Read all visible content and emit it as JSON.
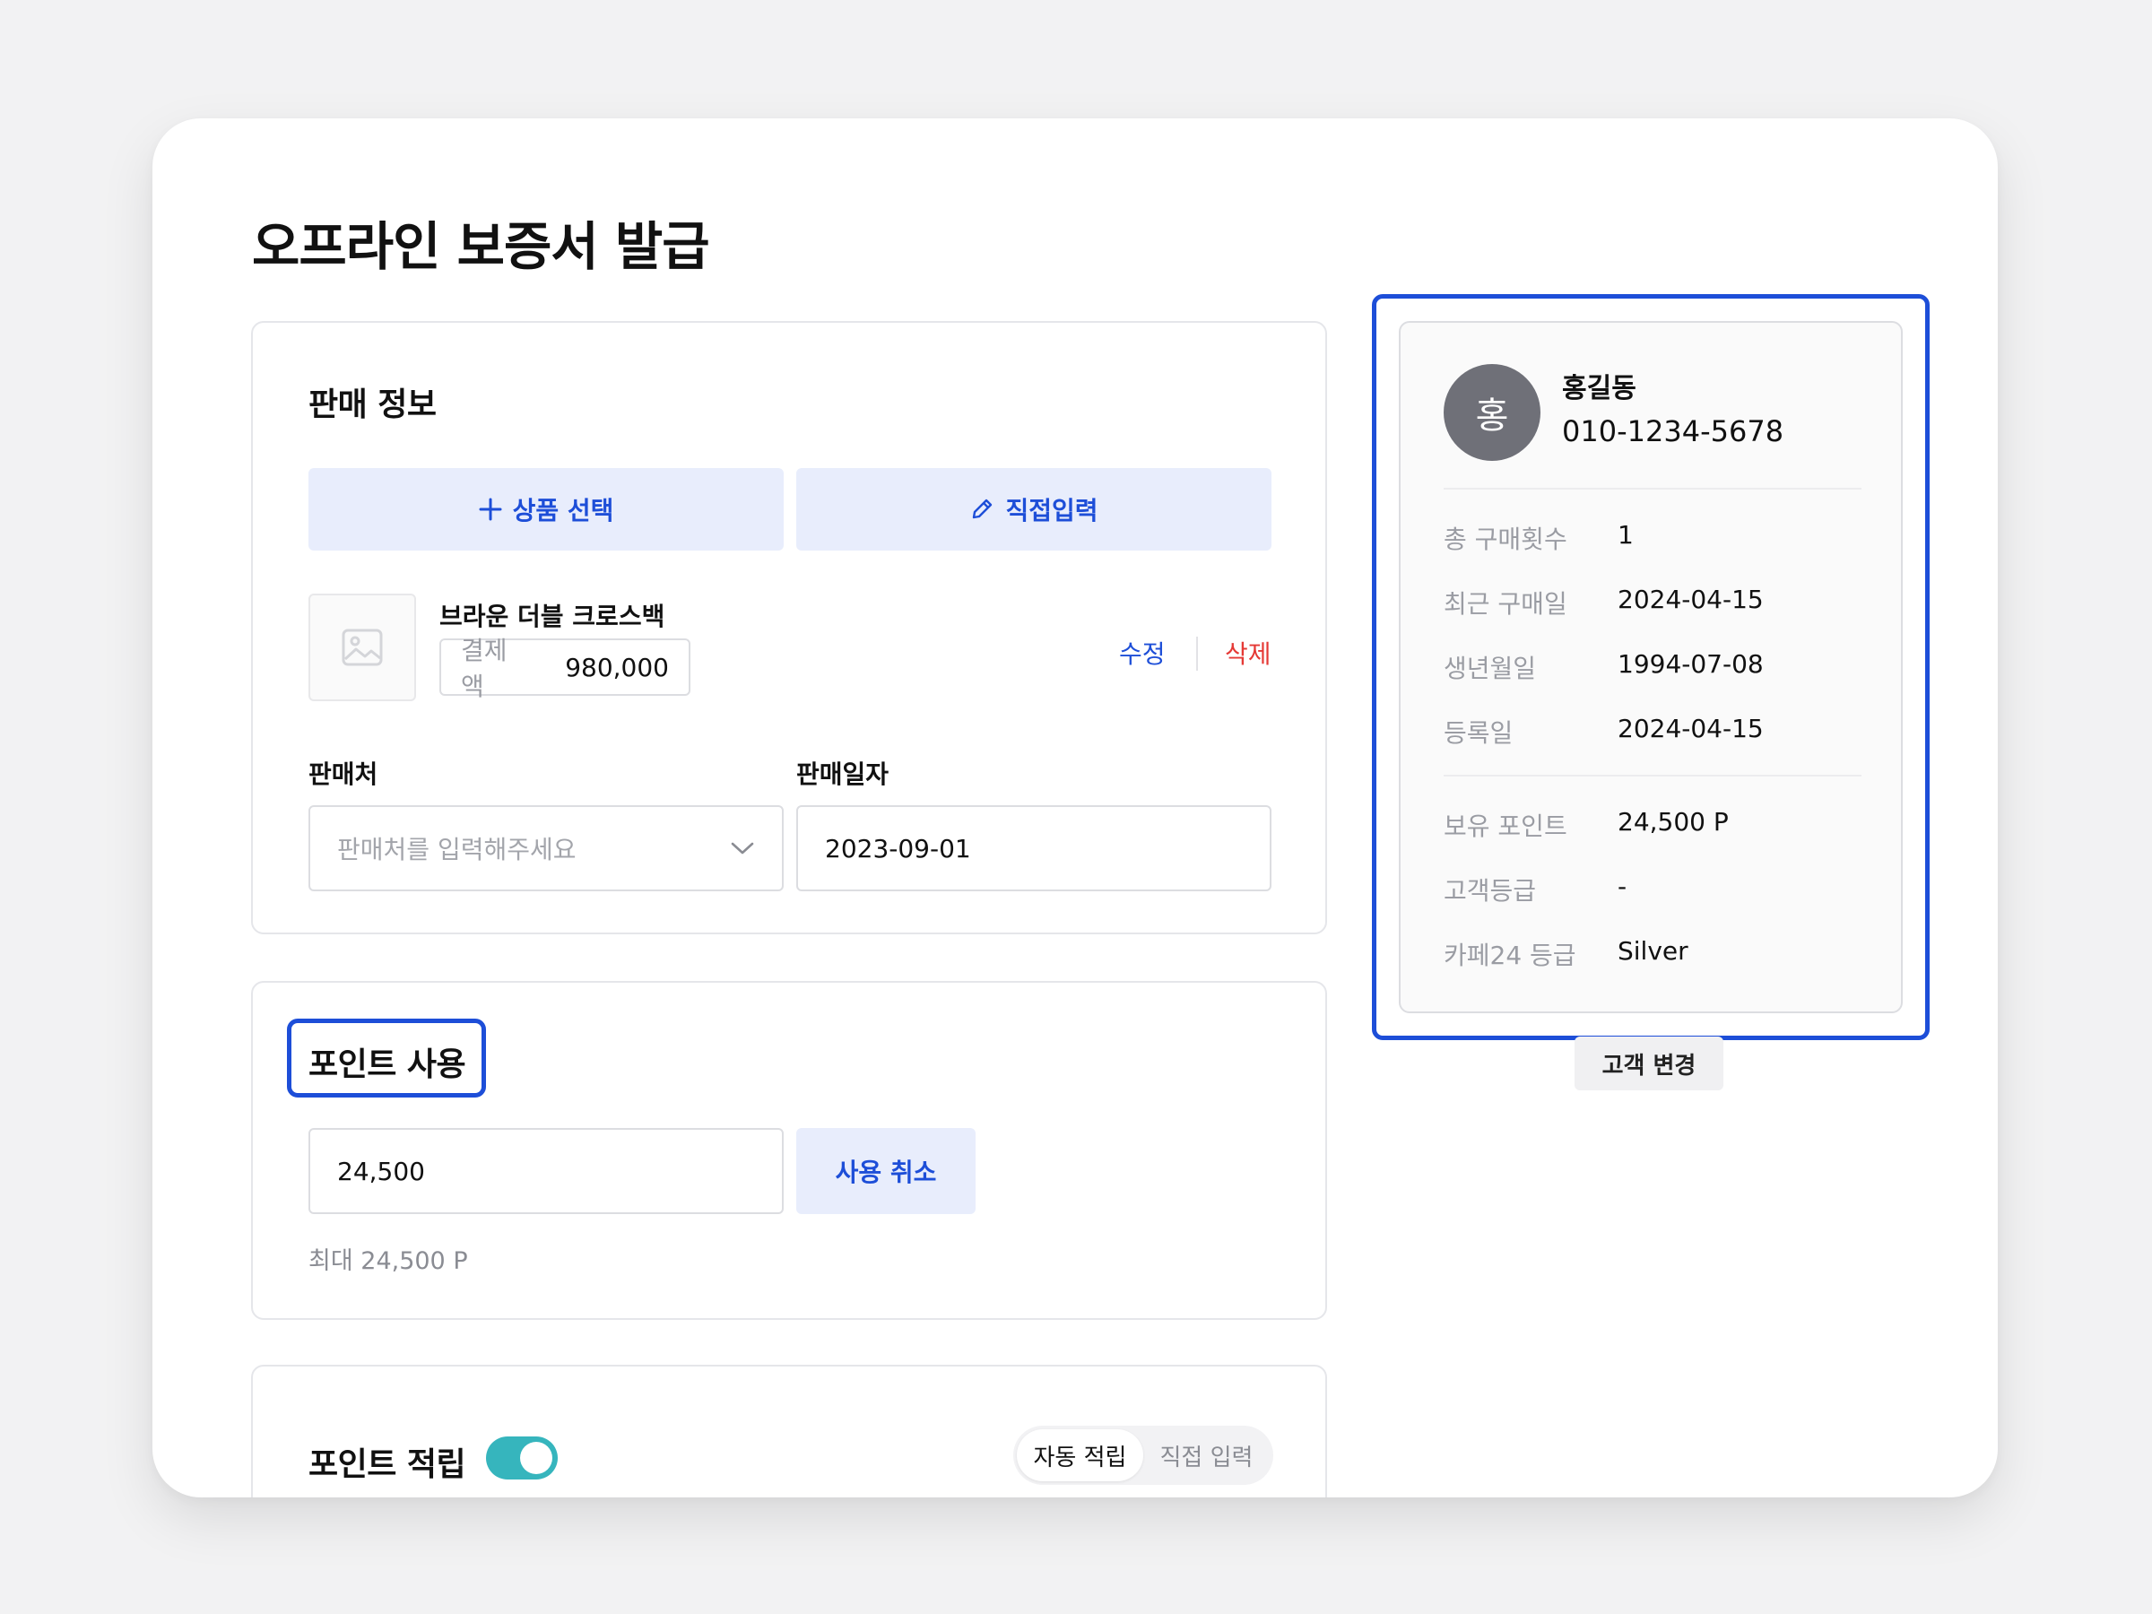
{
  "page": {
    "title": "오프라인 보증서 발급"
  },
  "sales": {
    "title": "판매 정보",
    "select_product_label": "상품 선택",
    "direct_input_label": "직접입력",
    "product": {
      "name": "브라운 더블 크로스백",
      "payment_label": "결제액",
      "payment_value": "980,000",
      "edit_label": "수정",
      "delete_label": "삭제"
    },
    "store_label": "판매처",
    "store_placeholder": "판매처를 입력해주세요",
    "date_label": "판매일자",
    "date_value": "2023-09-01"
  },
  "points_use": {
    "title": "포인트 사용",
    "input_value": "24,500",
    "cancel_label": "사용 취소",
    "max_hint": "최대 24,500 P"
  },
  "points_earn": {
    "title": "포인트 적립",
    "toggle_on": true,
    "seg_auto": "자동 적립",
    "seg_manual": "직접 입력"
  },
  "customer": {
    "avatar_initial": "홍",
    "name": "홍길동",
    "phone": "010-1234-5678",
    "rows": [
      {
        "label": "총 구매횟수",
        "value": "1"
      },
      {
        "label": "최근 구매일",
        "value": "2024-04-15"
      },
      {
        "label": "생년월일",
        "value": "1994-07-08"
      },
      {
        "label": "등록일",
        "value": "2024-04-15"
      }
    ],
    "rows2": [
      {
        "label": "보유 포인트",
        "value": "24,500 P"
      },
      {
        "label": "고객등급",
        "value": "-"
      },
      {
        "label": "카페24 등급",
        "value": "Silver"
      }
    ],
    "change_label": "고객 변경"
  },
  "colors": {
    "accent": "#1d4ed8",
    "soft_button": "#e8edfc",
    "danger": "#e53935",
    "toggle": "#36b5bd",
    "avatar": "#6f7078"
  }
}
